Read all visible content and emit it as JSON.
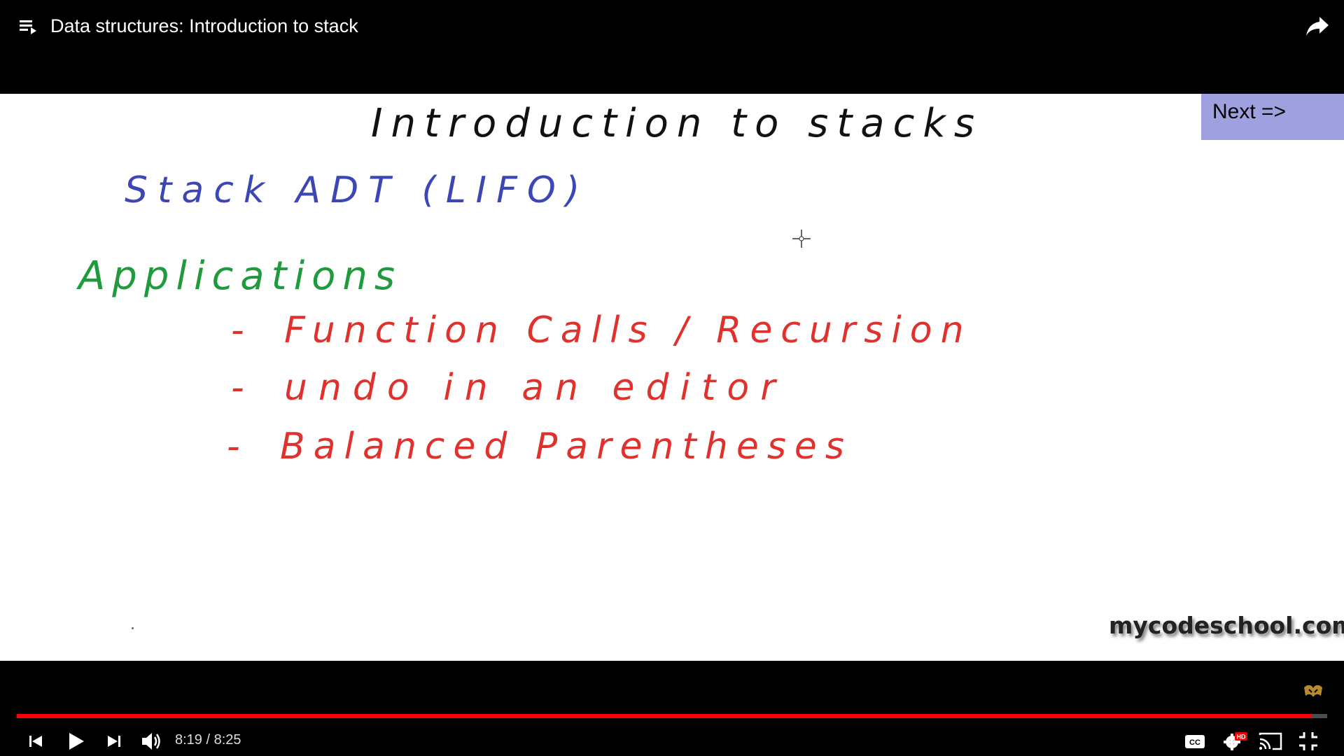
{
  "header": {
    "title": "Data structures: Introduction to stack",
    "playlist_icon": "playlist-icon",
    "share_icon": "share-icon"
  },
  "slide": {
    "title": "Introduction to stacks",
    "subtitle": "Stack ADT (LIFO)",
    "section_heading": "Applications",
    "bullet_symbol": "-",
    "items": [
      "Function Calls / Recursion",
      "undo in an editor",
      "Balanced Parentheses"
    ],
    "colors": {
      "title": "#111111",
      "subtitle": "#3c46b4",
      "heading": "#1f9a3c",
      "items": "#e0312d"
    }
  },
  "overlay": {
    "next_button_label": "Next =>",
    "next_button_color": "#9fa0df",
    "watermark": "mycodeschool.com",
    "cursor_icon": "crosshair-icon"
  },
  "controls": {
    "current_time": "8:19",
    "separator": " / ",
    "duration": "8:25",
    "progress_fraction": 0.988,
    "progress_color": "#ff0000",
    "hd_badge": "HD",
    "icons": {
      "previous": "skip-previous-icon",
      "play": "play-icon",
      "next": "skip-next-icon",
      "volume": "volume-icon",
      "captions": "captions-icon",
      "settings": "settings-gear-icon",
      "cast": "cast-icon",
      "exit_fullscreen": "exit-fullscreen-icon",
      "channel": "channel-logo-icon"
    }
  }
}
